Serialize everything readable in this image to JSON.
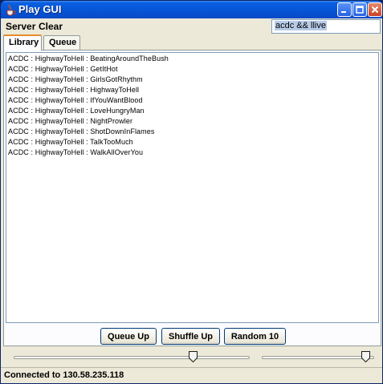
{
  "window": {
    "title": "Play GUI",
    "icon": "java-coffee-icon",
    "controls": [
      "minimize-icon",
      "maximize-icon",
      "close-icon"
    ]
  },
  "menubar": {
    "items": [
      {
        "label": "Server"
      },
      {
        "label": "Clear"
      }
    ],
    "search": {
      "value": "acdc && llive"
    }
  },
  "tabs": [
    {
      "label": "Library",
      "active": true
    },
    {
      "label": "Queue",
      "active": false
    }
  ],
  "library": {
    "items": [
      "ACDC : HighwayToHell : BeatingAroundTheBush",
      "ACDC : HighwayToHell : GetItHot",
      "ACDC : HighwayToHell : GirlsGotRhythm",
      "ACDC : HighwayToHell : HighwayToHell",
      "ACDC : HighwayToHell : IfYouWantBlood",
      "ACDC : HighwayToHell : LoveHungryMan",
      "ACDC : HighwayToHell : NightProwler",
      "ACDC : HighwayToHell : ShotDownInFlames",
      "ACDC : HighwayToHell : TalkTooMuch",
      "ACDC : HighwayToHell : WalkAllOverYou"
    ]
  },
  "buttons": {
    "queue_up": "Queue Up",
    "shuffle_up": "Shuffle Up",
    "random_10": "Random 10"
  },
  "sliders": {
    "position_value": 0.77,
    "volume_value": 0.96
  },
  "status": {
    "text": "Connected to 130.58.235.118"
  },
  "colors": {
    "title_bar": "#0553d6",
    "window_bg": "#ece9d8",
    "active_tab_accent": "#e68b2c",
    "button_border": "#003c74"
  }
}
